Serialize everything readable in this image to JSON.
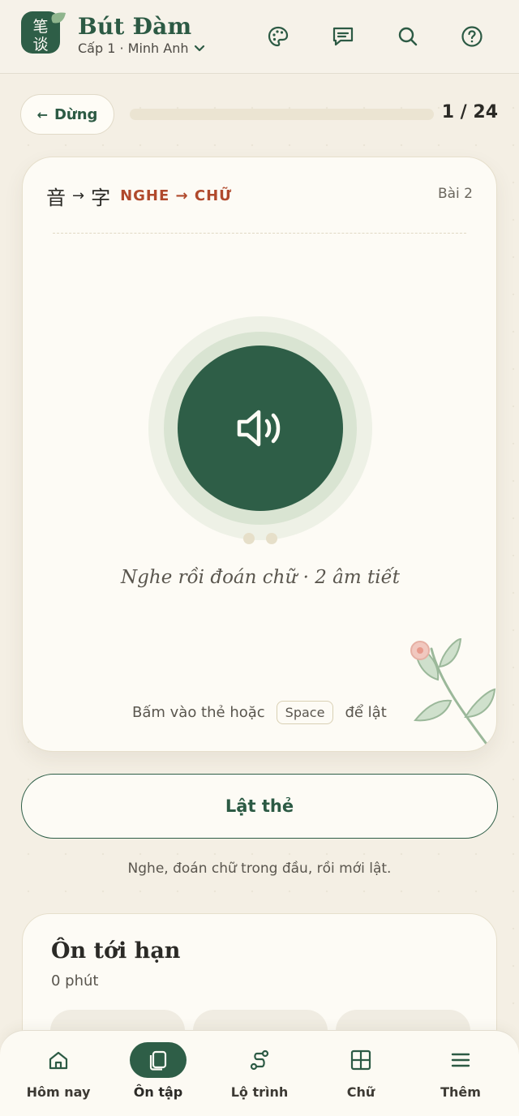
{
  "app": {
    "logo_chars": [
      "笔",
      "谈"
    ],
    "title": "Bút Đàm",
    "level_label": "Cấp 1 · Minh Anh"
  },
  "header_icons": [
    "palette-icon",
    "chat-icon",
    "search-icon",
    "help-icon"
  ],
  "session": {
    "stop_label": "Dừng",
    "stop_arrow": "←",
    "progress_current": 1,
    "progress_total": 24,
    "progress_text": "1 / 24",
    "progress_fraction": 0.0
  },
  "card": {
    "mode_from_han": "音",
    "mode_arrow": "→",
    "mode_to_han": "字",
    "mode_label": "NGHE → CHỮ",
    "lesson": "Bài 2",
    "syllable_count": 2,
    "hint": "Nghe rồi đoán chữ · 2 âm tiết",
    "flip_prefix": "Bấm vào thẻ hoặc",
    "flip_key": "Space",
    "flip_suffix": "để lật"
  },
  "flip_button_label": "Lật thẻ",
  "sub_hint": "Nghe, đoán chữ trong đầu, rồi mới lật.",
  "due_section": {
    "title": "Ôn tới hạn",
    "subtitle": "0 phút"
  },
  "nav": [
    {
      "label": "Hôm nay",
      "icon": "home-icon",
      "active": false
    },
    {
      "label": "Ôn tập",
      "icon": "cards-icon",
      "active": true
    },
    {
      "label": "Lộ trình",
      "icon": "route-icon",
      "active": false
    },
    {
      "label": "Chữ",
      "icon": "character-grid-icon",
      "active": false
    },
    {
      "label": "Thêm",
      "icon": "menu-icon",
      "active": false
    }
  ],
  "colors": {
    "accent_green": "#2e5e47",
    "mode_red": "#b0492c",
    "background": "#f4efe4"
  }
}
